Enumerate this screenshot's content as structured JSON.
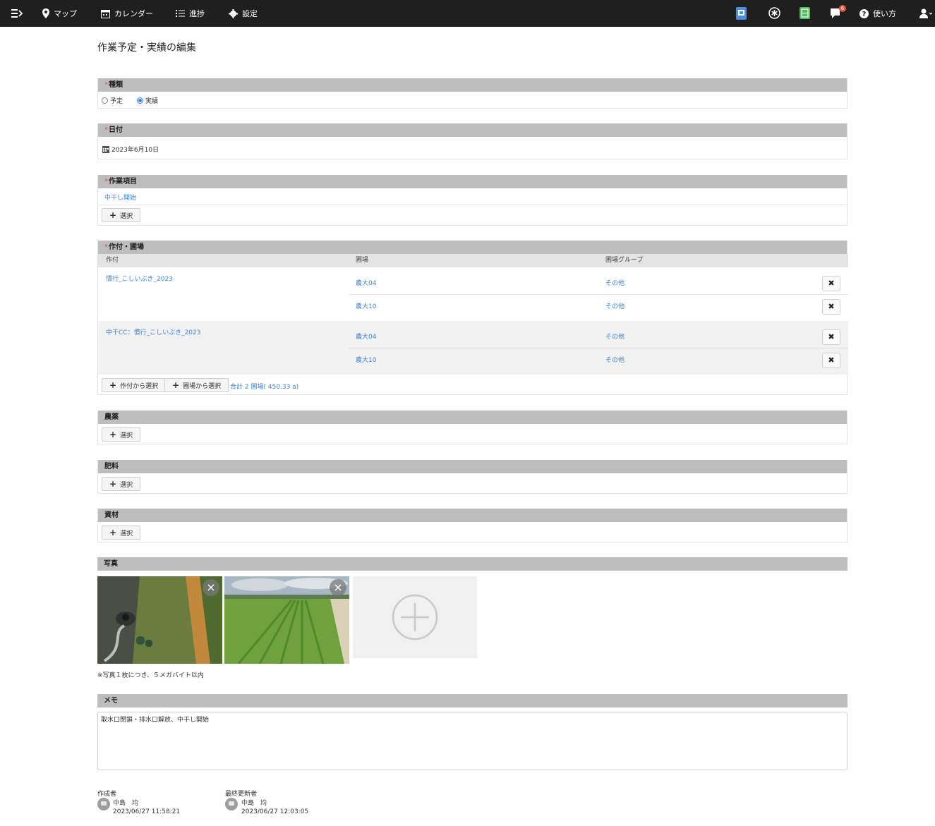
{
  "nav": {
    "map": "マップ",
    "calendar": "カレンダー",
    "progress": "進捗",
    "settings": "設定",
    "help": "使い方",
    "notification_count": "6"
  },
  "page": {
    "title": "作業予定・実績の編集"
  },
  "type_section": {
    "header": "種類",
    "options": [
      "予定",
      "実績"
    ],
    "selected": "実績"
  },
  "date_section": {
    "header": "日付",
    "value": "2023年6月10日"
  },
  "work_section": {
    "header": "作業項目",
    "value": "中干し開始",
    "select_label": "選択"
  },
  "crop_section": {
    "header": "作付・圃場",
    "columns": [
      "作付",
      "圃場",
      "圃場グループ"
    ],
    "groups": [
      {
        "crop": "慣行_こしいぶき_2023",
        "rows": [
          {
            "field": "農大04",
            "group": "その他"
          },
          {
            "field": "農大10",
            "group": "その他"
          }
        ]
      },
      {
        "crop": "中干CC：慣行_こしいぶき_2023",
        "rows": [
          {
            "field": "農大04",
            "group": "その他"
          },
          {
            "field": "農大10",
            "group": "その他"
          }
        ]
      }
    ],
    "select_from_crop": "作付から選択",
    "select_from_field": "圃場から選択",
    "total": "合計 2 圃場( 450.33 a)",
    "delete_label": "✖"
  },
  "pesticide_section": {
    "header": "農薬",
    "select_label": "選択"
  },
  "fertilizer_section": {
    "header": "肥料",
    "select_label": "選択"
  },
  "material_section": {
    "header": "資材",
    "select_label": "選択"
  },
  "photo_section": {
    "header": "写真",
    "note": "※写真１枚につき、５メガバイト以内",
    "remove_label": "×"
  },
  "memo_section": {
    "header": "メモ",
    "value": "取水口閉鎖・排水口解放、中干し開始"
  },
  "footer": {
    "creator_label": "作成者",
    "creator_name": "中島　均",
    "creator_time": "2023/06/27 11:58:21",
    "updater_label": "最終更新者",
    "updater_name": "中島　均",
    "updater_time": "2023/06/27 12:03:05"
  },
  "colors": {
    "link": "#3a83d6",
    "header_bg": "#bdbdbd",
    "nav_bg": "#1f1f1f",
    "required": "#d9534f"
  }
}
